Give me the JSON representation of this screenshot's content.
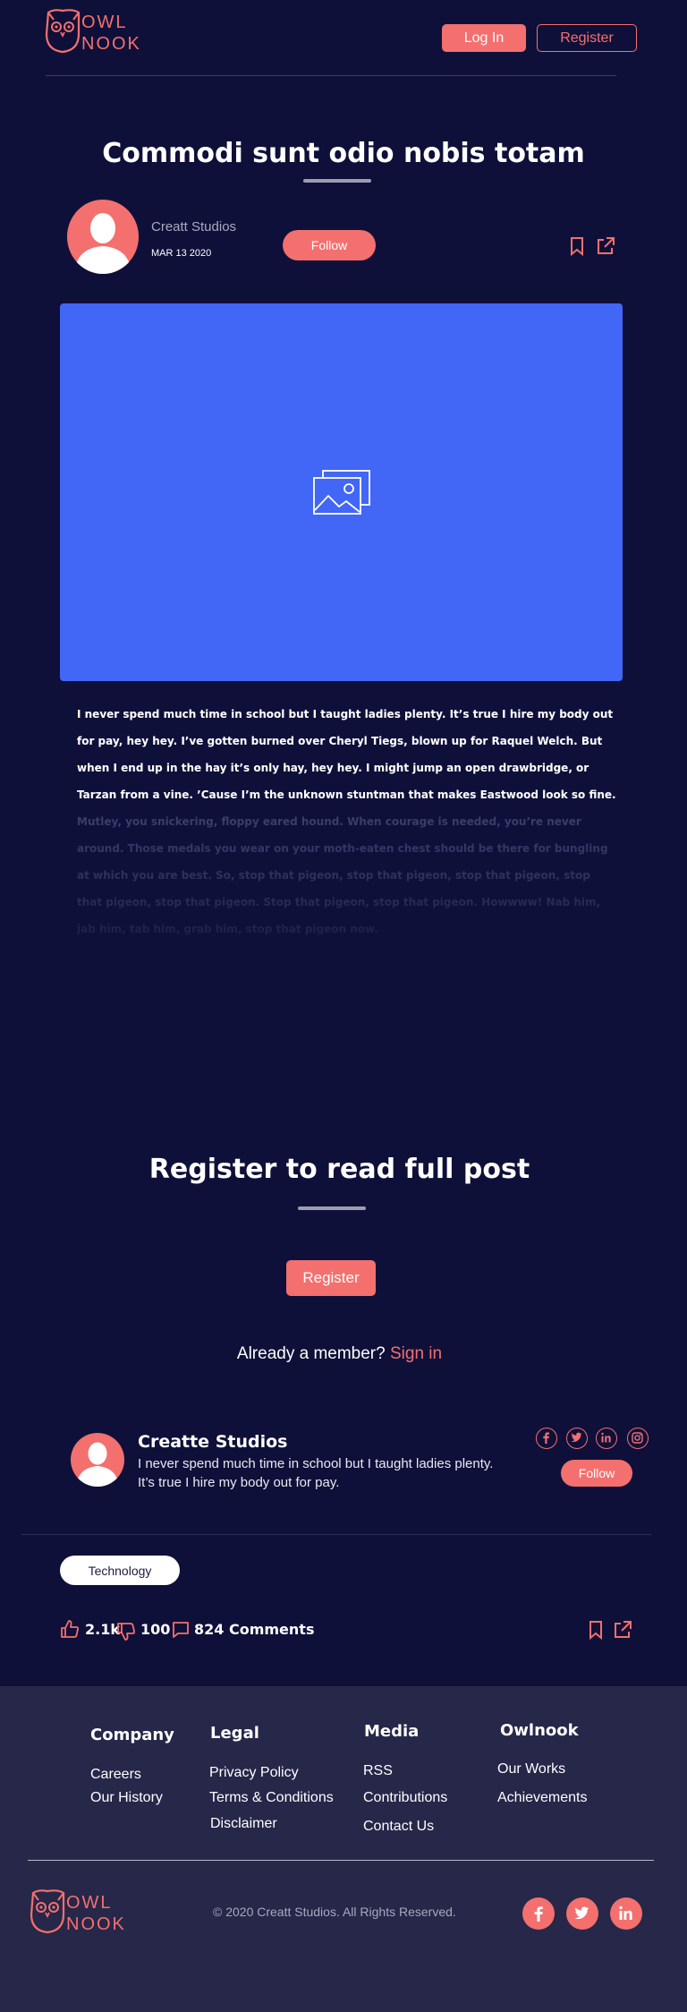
{
  "header": {
    "logo_line1": "OWL",
    "logo_line2": "NOOK",
    "login_label": "Log In",
    "register_label": "Register"
  },
  "post": {
    "title": "Commodi sunt odio nobis totam",
    "author": "Creatt Studios",
    "date": "MAR 13 2020",
    "follow_label": "Follow",
    "paragraph1": "I never spend much time in school but I taught ladies plenty. It’s true I hire my body out for pay, hey hey. I’ve gotten burned over Cheryl Tiegs, blown up for Raquel Welch. But when I end up in the hay it’s only hay, hey hey. I might jump an open drawbridge, or Tarzan from a vine. ’Cause I’m the unknown stuntman that makes Eastwood look so fine.",
    "paragraph2": "Mutley, you snickering, floppy eared hound. When courage is needed, you’re never around. Those medals you wear on your moth-eaten chest should be there for bungling at which you are best. So, stop that pigeon, stop that pigeon, stop that pigeon, stop that pigeon, stop that pigeon. Stop that pigeon, stop that pigeon. Howwww! Nab him, jab him, tab him, grab him, stop that pigeon now."
  },
  "register_gate": {
    "title": "Register to read full post",
    "button_label": "Register",
    "member_text": "Already a member?",
    "signin_text": "Sign in"
  },
  "author_card": {
    "name": "Creatte Studios",
    "bio": "I never spend much time in school but I taught ladies plenty. It’s true I hire my body out for pay.",
    "follow_label": "Follow",
    "socials": [
      "facebook-icon",
      "twitter-icon",
      "linkedin-icon",
      "instagram-icon"
    ]
  },
  "meta": {
    "tag": "Technology",
    "likes": "2.1k",
    "dislikes": "100",
    "comments": "824 Comments"
  },
  "footer": {
    "columns": [
      {
        "heading": "Company",
        "links": [
          "Careers",
          "Our History"
        ]
      },
      {
        "heading": "Legal",
        "links": [
          "Privacy Policy",
          "Terms & Conditions",
          "Disclaimer"
        ]
      },
      {
        "heading": "Media",
        "links": [
          "RSS",
          "Contributions",
          "Contact Us"
        ]
      },
      {
        "heading": "Owlnook",
        "links": [
          "Our Works",
          "Achievements"
        ]
      }
    ],
    "logo_line1": "OWL",
    "logo_line2": "NOOK",
    "copyright": "© 2020 Creatt Studios. All Rights Reserved.",
    "socials": [
      "facebook-icon",
      "twitter-icon",
      "linkedin-icon"
    ]
  },
  "colors": {
    "background": "#0f1039",
    "accent": "#f3706e",
    "hero": "#4266f5",
    "footer": "#262749"
  }
}
